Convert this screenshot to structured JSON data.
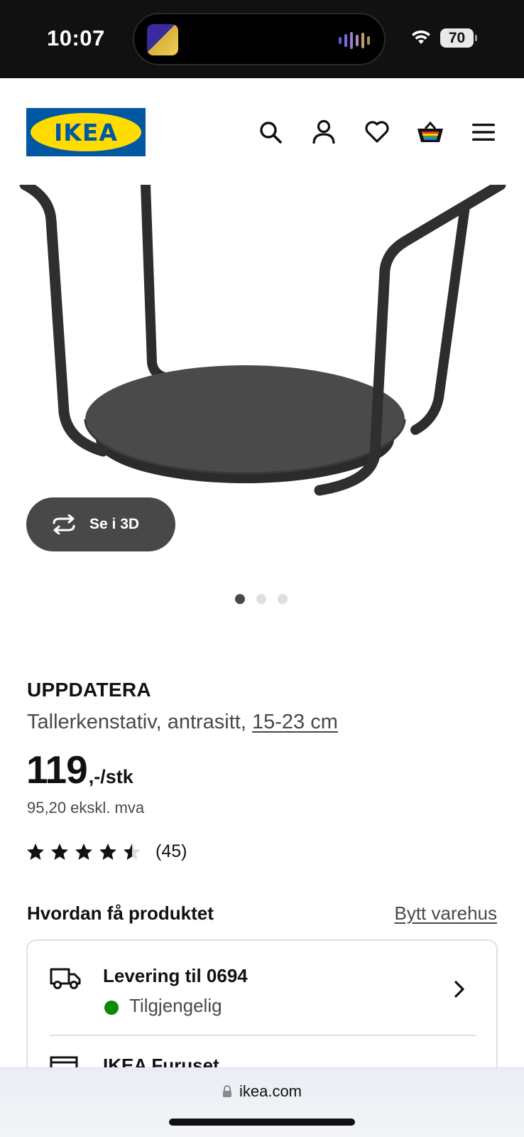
{
  "status_bar": {
    "time": "10:07",
    "battery": "70"
  },
  "header": {
    "logo_text": "IKEA",
    "icons": [
      "search-icon",
      "account-icon",
      "heart-icon",
      "cart-icon",
      "menu-icon"
    ]
  },
  "gallery": {
    "view_3d_label": "Se i 3D",
    "image_count": 3,
    "active_index": 0
  },
  "product": {
    "name": "UPPDATERA",
    "description": "Tallerkenstativ, antrasitt,",
    "size": "15-23 cm",
    "price": "119",
    "price_suffix": ",-/stk",
    "price_ex_vat": "95,20 ekskl. mva",
    "rating": 4.5,
    "review_count": "(45)"
  },
  "availability": {
    "title": "Hvordan få produktet",
    "change_store": "Bytt varehus",
    "delivery_title": "Levering til 0694",
    "delivery_status": "Tilgjengelig",
    "store_title": "IKEA Furuset"
  },
  "browser": {
    "url": "ikea.com"
  },
  "colors": {
    "ikea_blue": "#0058a3",
    "ikea_yellow": "#ffdb00",
    "available_green": "#0a8a00",
    "button_dark": "#484848"
  }
}
